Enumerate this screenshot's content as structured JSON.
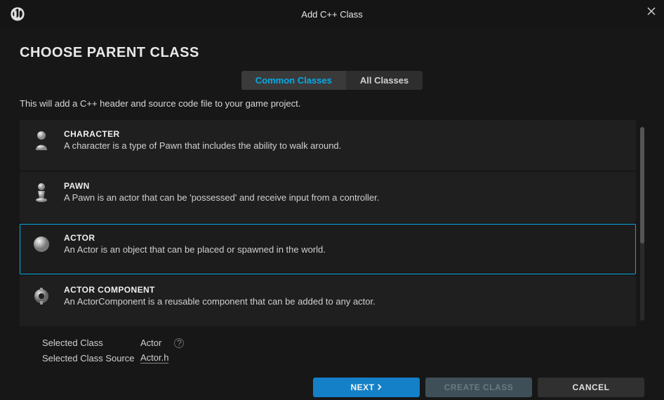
{
  "dialog": {
    "title": "Add C++ Class"
  },
  "page": {
    "heading": "CHOOSE PARENT CLASS",
    "description": "This will add a C++ header and source code file to your game project."
  },
  "tabs": {
    "common": "Common Classes",
    "all": "All Classes"
  },
  "classList": [
    {
      "title": "CHARACTER",
      "desc": "A character is a type of Pawn that includes the ability to walk around.",
      "icon": "character",
      "selected": false
    },
    {
      "title": "PAWN",
      "desc": "A Pawn is an actor that can be 'possessed' and receive input from a controller.",
      "icon": "pawn",
      "selected": false
    },
    {
      "title": "ACTOR",
      "desc": "An Actor is an object that can be placed or spawned in the world.",
      "icon": "actor",
      "selected": true
    },
    {
      "title": "ACTOR COMPONENT",
      "desc": "An ActorComponent is a reusable component that can be added to any actor.",
      "icon": "component",
      "selected": false
    }
  ],
  "info": {
    "selectedClassLabel": "Selected Class",
    "selectedClassValue": "Actor",
    "selectedSourceLabel": "Selected Class Source",
    "selectedSourceValue": "Actor.h"
  },
  "buttons": {
    "next": "NEXT",
    "create": "CREATE CLASS",
    "cancel": "CANCEL"
  }
}
